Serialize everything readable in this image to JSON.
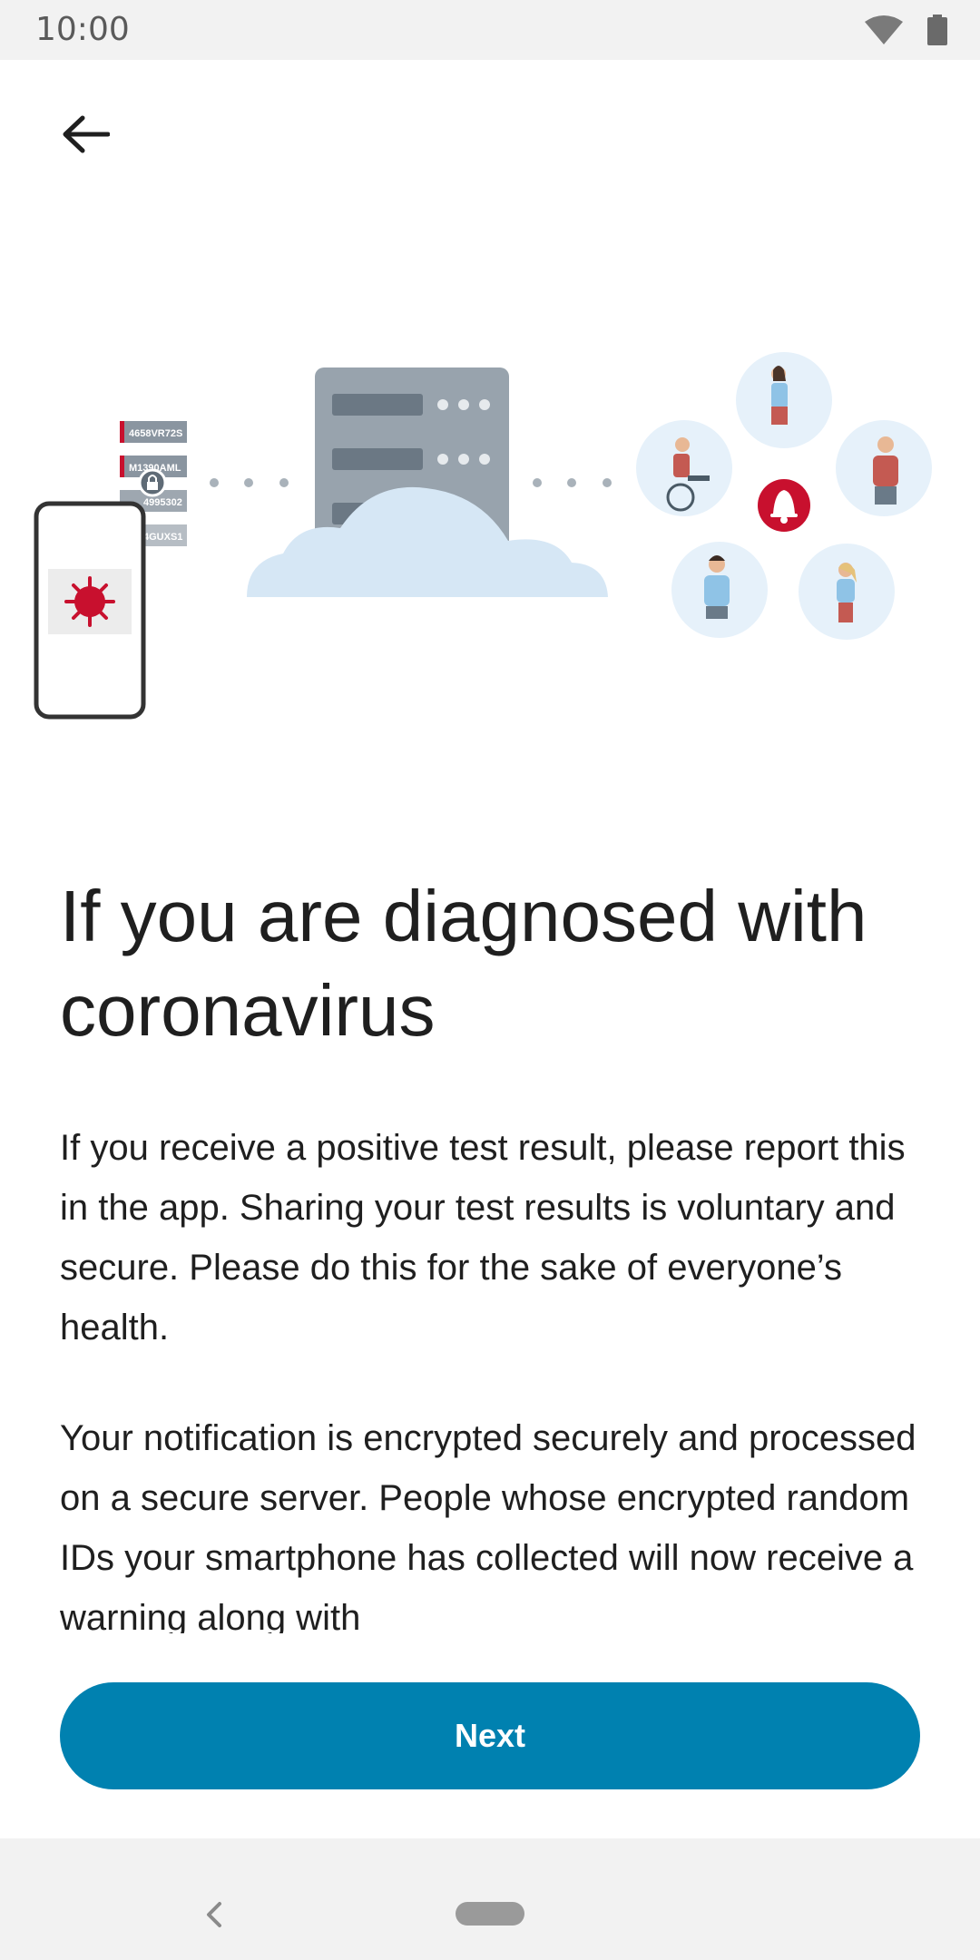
{
  "status_bar": {
    "time": "10:00",
    "icons": [
      "wifi-icon",
      "battery-icon"
    ]
  },
  "header": {
    "back_icon": "arrow-left-icon"
  },
  "illustration": {
    "id_tags": [
      "4658VR72S",
      "M1390AML",
      "4995302",
      "4GUXS1"
    ],
    "icons": [
      "virus-icon",
      "lock-icon",
      "bell-icon",
      "server-icon",
      "cloud-icon"
    ],
    "accent_color": "#c8102e"
  },
  "content": {
    "title": "If you are diagnosed with coronavirus",
    "paragraphs": [
      "If you receive a positive test result, please report this in the app. Sharing your test results is voluntary and secure. Please do this for the sake of everyone’s health.",
      "Your notification is encrypted securely and processed on a secure server. People whose encrypted random IDs your smartphone has collected will now receive a warning along with"
    ]
  },
  "actions": {
    "next_label": "Next",
    "button_color": "#0081b0"
  },
  "nav_bar": {
    "icons": [
      "nav-back-icon",
      "home-pill-icon"
    ]
  }
}
